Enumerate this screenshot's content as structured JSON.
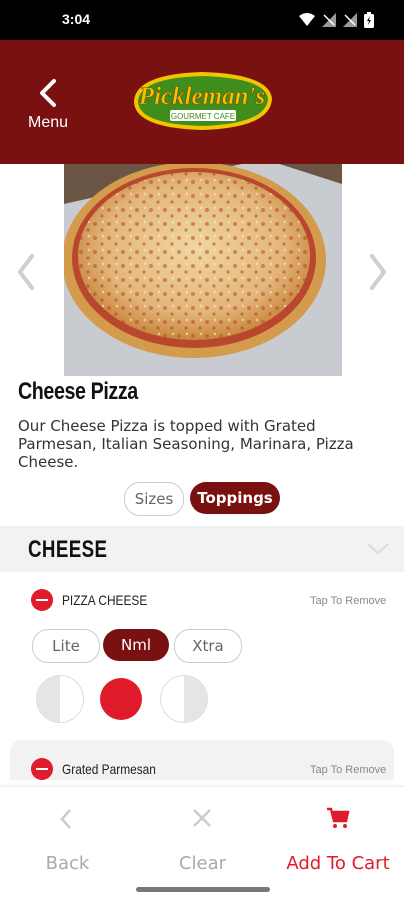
{
  "status": {
    "time": "3:04"
  },
  "header": {
    "menu_label": "Menu",
    "logo_text": "Pickleman's",
    "logo_subtext": "GOURMET CAFE"
  },
  "item": {
    "title": "Cheese Pizza",
    "description": "Our Cheese Pizza is topped with Grated Parmesan, Italian Seasoning, Marinara, Pizza Cheese."
  },
  "segments": {
    "sizes": "Sizes",
    "toppings": "Toppings",
    "selected": "Toppings"
  },
  "section": {
    "title": "CHEESE"
  },
  "toppings": [
    {
      "name": "PIZZA CHEESE",
      "action": "Tap To Remove",
      "amounts": [
        "Lite",
        "Nml",
        "Xtra"
      ],
      "selected_amount": "Nml",
      "coverage": "whole"
    },
    {
      "name": "Grated Parmesan",
      "action": "Tap To Remove"
    }
  ],
  "bottom": {
    "back": "Back",
    "clear": "Clear",
    "add_to_cart": "Add To Cart"
  },
  "colors": {
    "brand": "#7a1111",
    "accent": "#e01b2b"
  },
  "icons": [
    "wifi-icon",
    "signal-icon",
    "battery-icon",
    "back-chevron-icon",
    "carousel-prev-icon",
    "carousel-next-icon",
    "chevron-down-icon",
    "remove-minus-icon",
    "cart-icon",
    "close-icon"
  ]
}
